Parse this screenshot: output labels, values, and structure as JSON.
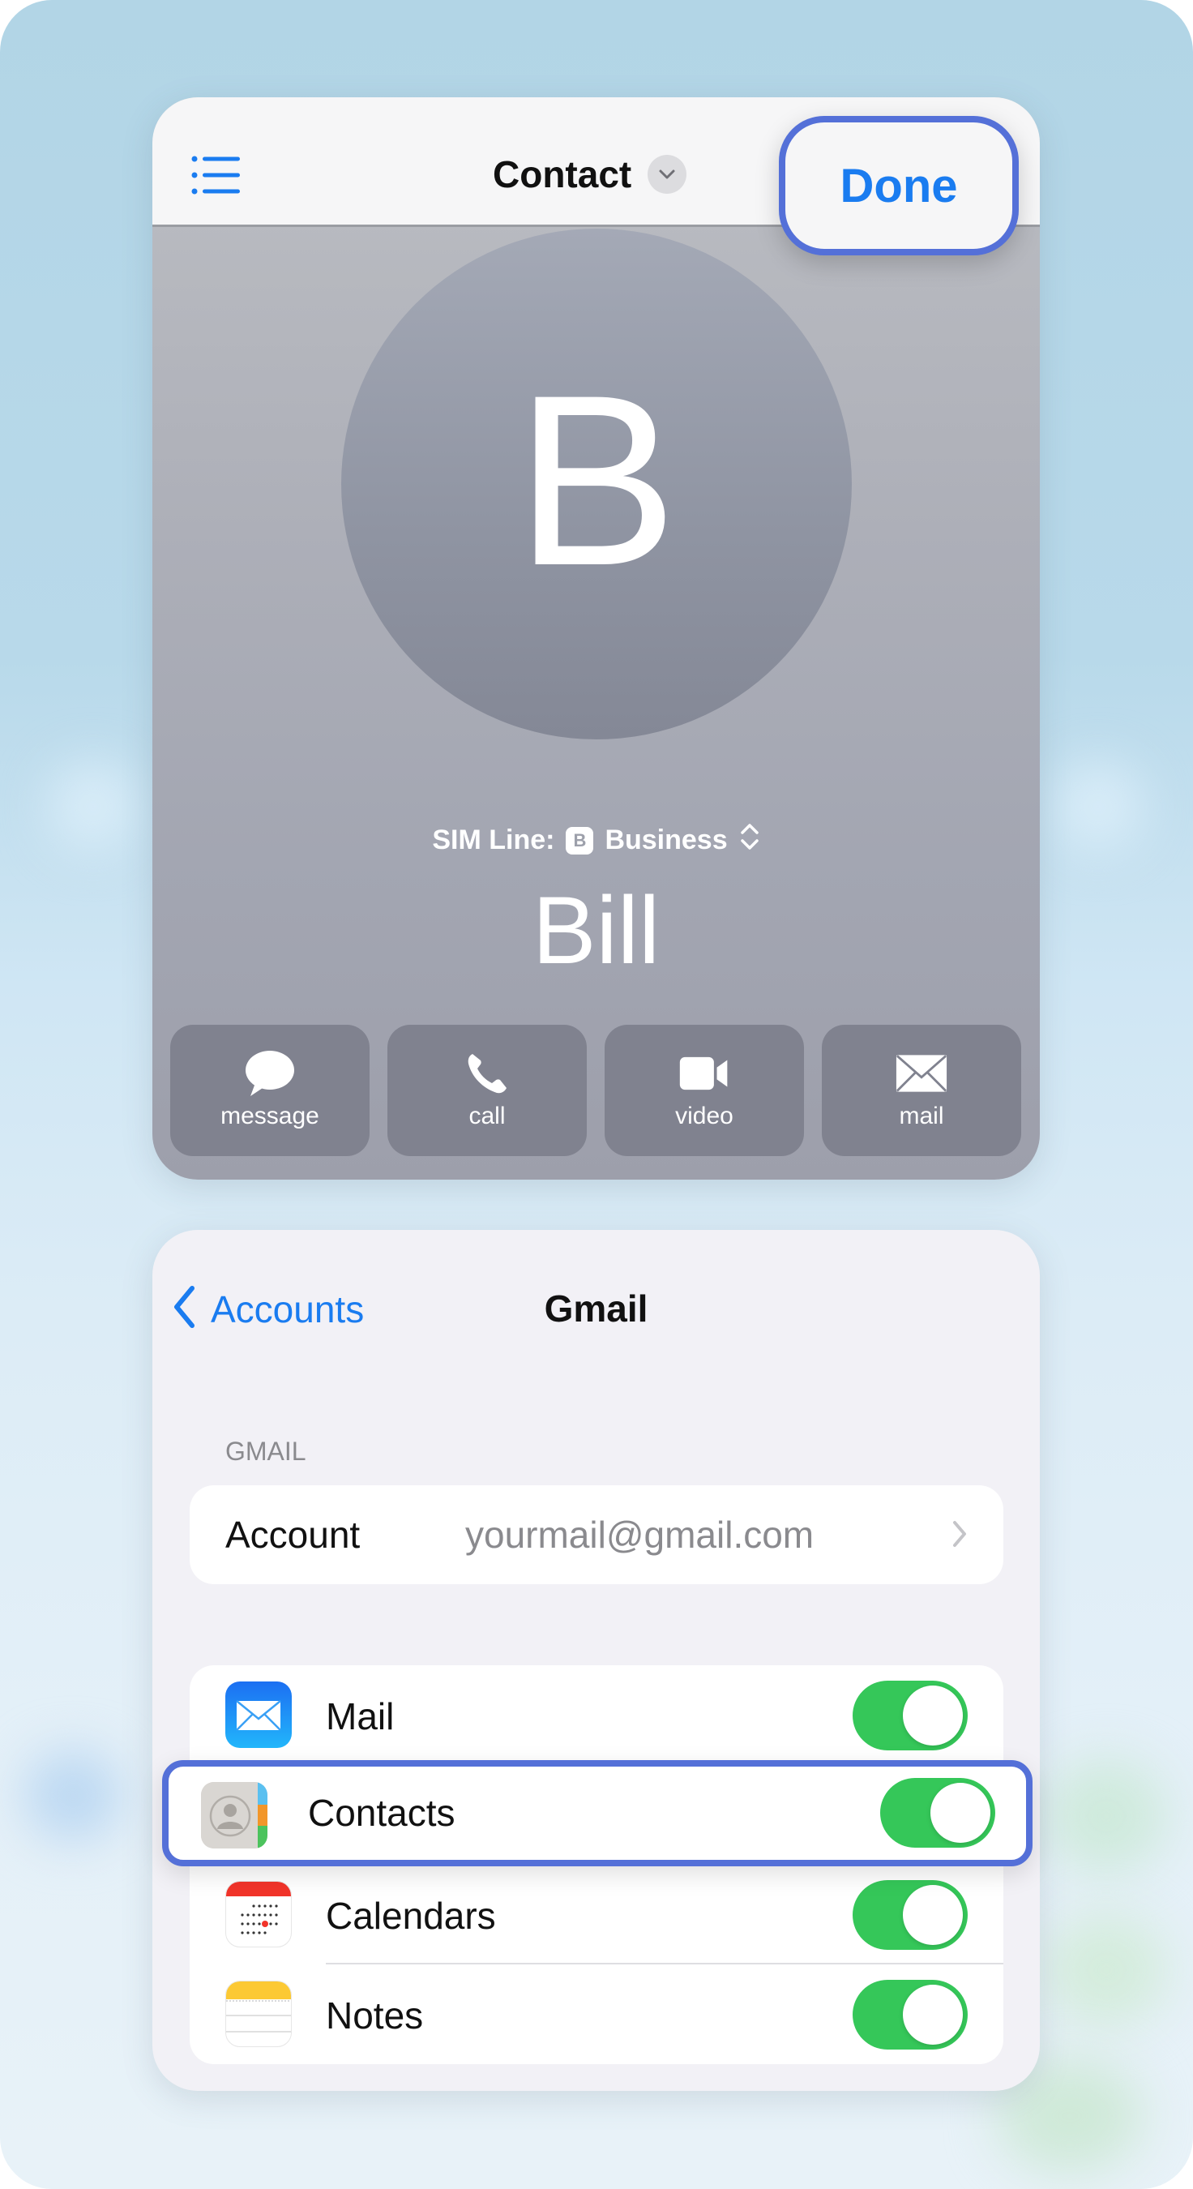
{
  "contact_card": {
    "header": {
      "title": "Contact",
      "done_label": "Done",
      "list_icon": "list-bullet-icon",
      "title_menu_icon": "chevron-down-circle-icon"
    },
    "avatar_initial": "B",
    "sim_line": {
      "label": "SIM Line:",
      "badge": "B",
      "value": "Business",
      "selector_icon": "chevron-up-down-icon"
    },
    "name": "Bill",
    "actions": [
      {
        "label": "message",
        "icon": "message-bubble-icon"
      },
      {
        "label": "call",
        "icon": "phone-icon"
      },
      {
        "label": "video",
        "icon": "video-camera-icon"
      },
      {
        "label": "mail",
        "icon": "envelope-icon"
      }
    ]
  },
  "settings_card": {
    "nav": {
      "back_label": "Accounts",
      "title": "Gmail"
    },
    "section_label": "GMAIL",
    "account": {
      "key": "Account",
      "value": "yourmail@gmail.com"
    },
    "toggles": [
      {
        "label": "Mail",
        "icon": "mail-app-icon",
        "on": true
      },
      {
        "label": "Contacts",
        "icon": "contacts-app-icon",
        "on": true
      },
      {
        "label": "Calendars",
        "icon": "calendar-app-icon",
        "on": true
      },
      {
        "label": "Notes",
        "icon": "notes-app-icon",
        "on": true
      }
    ]
  },
  "colors": {
    "accent_blue": "#1a7cf0",
    "highlight": "#5470d8",
    "toggle_on": "#35c759"
  }
}
